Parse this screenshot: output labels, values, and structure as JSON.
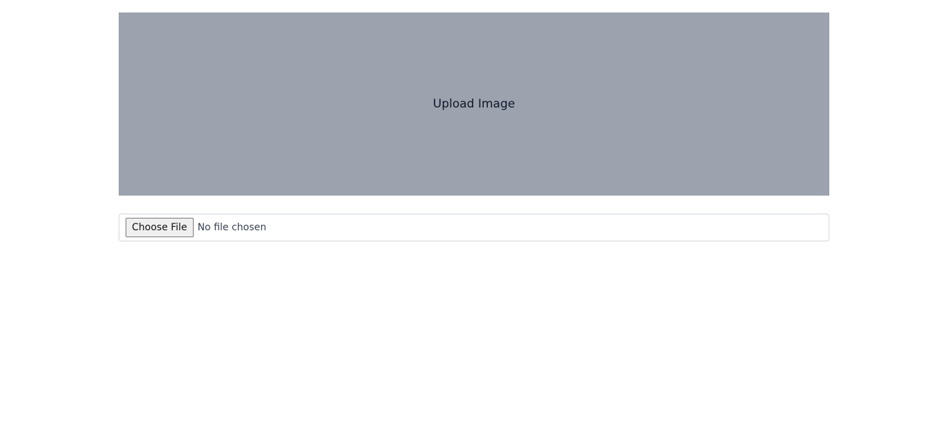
{
  "preview": {
    "label": "Upload Image",
    "background_color": "#9ca3af"
  },
  "file_input": {
    "button_label": "Choose File",
    "status_text": "No file chosen"
  }
}
